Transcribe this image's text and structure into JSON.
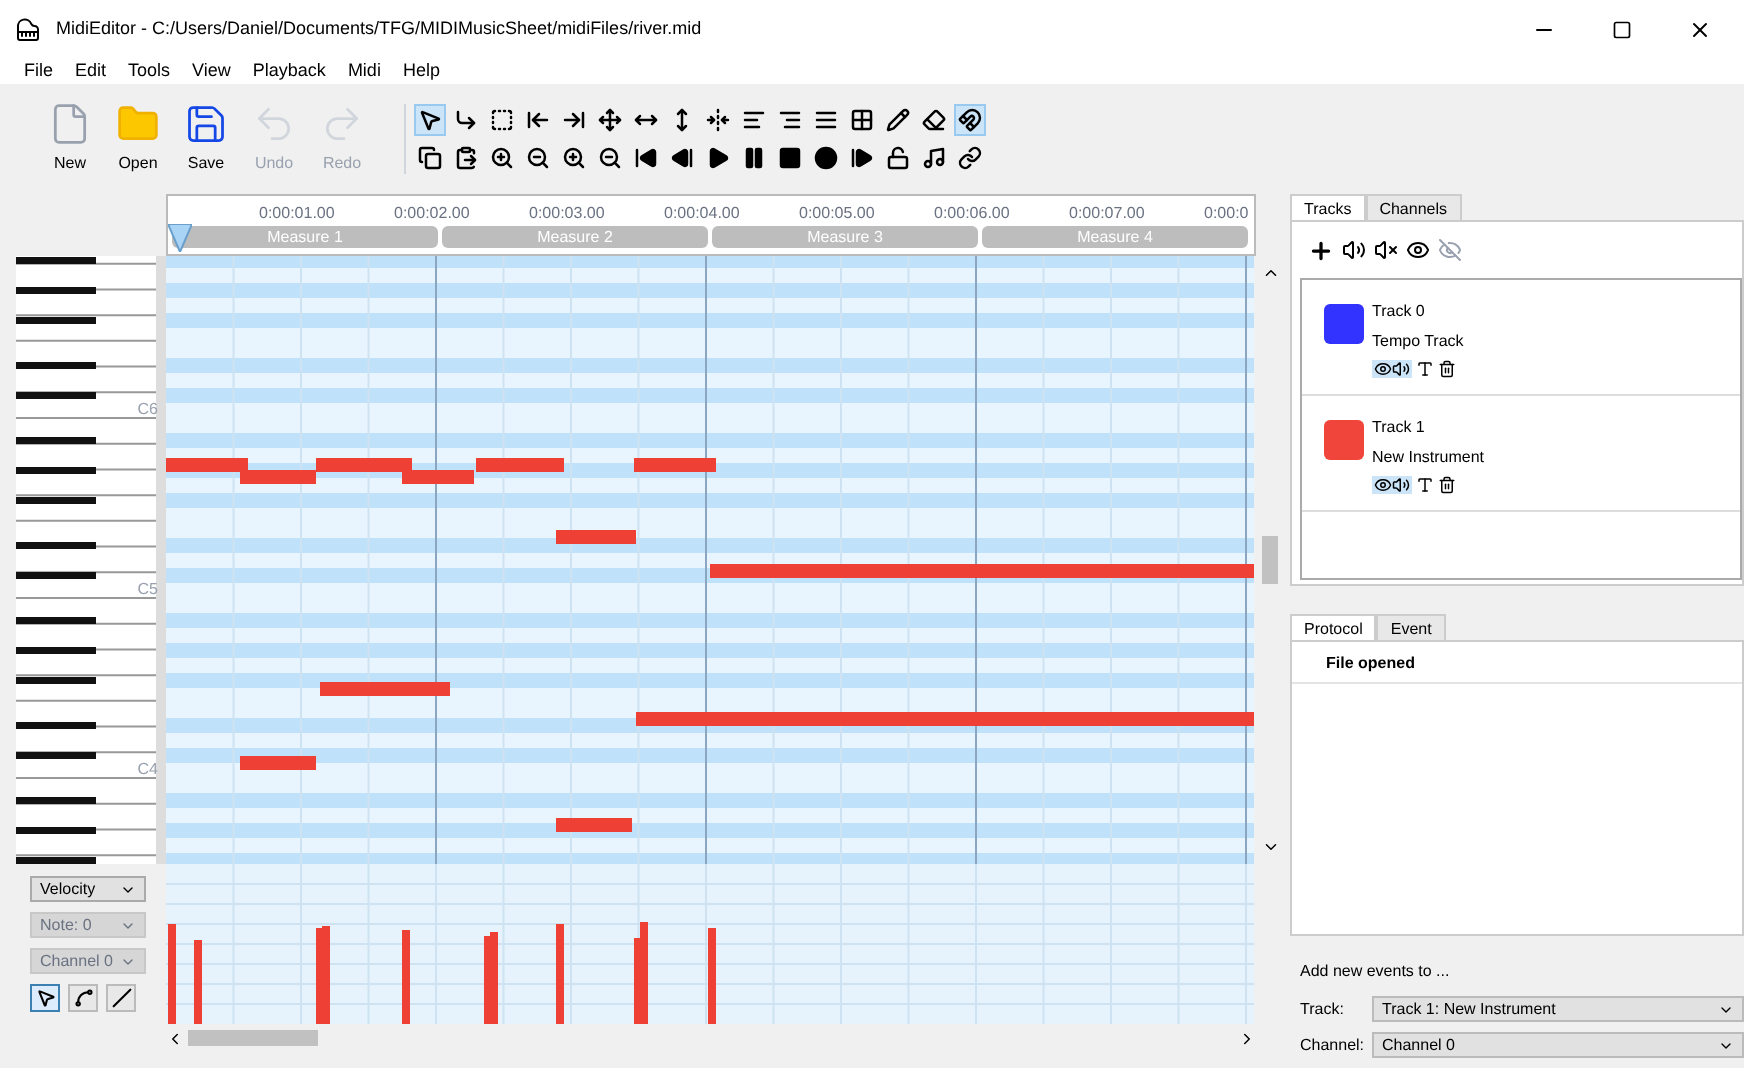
{
  "window": {
    "title": "MidiEditor - C:/Users/Daniel/Documents/TFG/MIDIMusicSheet/midiFiles/river.mid"
  },
  "menu": [
    "File",
    "Edit",
    "Tools",
    "View",
    "Playback",
    "Midi",
    "Help"
  ],
  "toolbar": {
    "large_buttons": [
      {
        "label": "New",
        "disabled": false
      },
      {
        "label": "Open",
        "disabled": false
      },
      {
        "label": "Save",
        "disabled": false
      },
      {
        "label": "Undo",
        "disabled": true
      },
      {
        "label": "Redo",
        "disabled": true
      }
    ],
    "tools": [
      {
        "selected": true
      },
      {
        "selected": false
      },
      {
        "selected": false
      },
      {
        "selected": false
      },
      {
        "selected": false
      },
      {
        "selected": false
      },
      {
        "selected": false
      },
      {
        "selected": false
      },
      {
        "selected": false
      },
      {
        "selected": false
      },
      {
        "selected": false
      },
      {
        "selected": false
      },
      {
        "selected": false
      },
      {
        "selected": false
      },
      {
        "selected": false
      },
      {
        "selected": true
      }
    ]
  },
  "timeline": {
    "ticks": [
      "0:00:01.00",
      "0:00:02.00",
      "0:00:03.00",
      "0:00:04.00",
      "0:00:05.00",
      "0:00:06.00",
      "0:00:07.00",
      "0:00:0"
    ],
    "measures": [
      "Measure 1",
      "Measure 2",
      "Measure 3",
      "Measure 4"
    ]
  },
  "keyboard": {
    "labels": [
      "C6",
      "C5",
      "C4"
    ]
  },
  "misc_panel": {
    "selects": [
      {
        "value": "Velocity",
        "disabled": false
      },
      {
        "value": "Note: 0",
        "disabled": true
      },
      {
        "value": "Channel 0",
        "disabled": true
      }
    ],
    "tools": [
      {
        "selected": true
      },
      {
        "selected": false
      },
      {
        "selected": false
      }
    ]
  },
  "right_tabs": [
    {
      "label": "Tracks",
      "selected": true
    },
    {
      "label": "Channels",
      "selected": false
    }
  ],
  "tracks": [
    {
      "name": "Track 0",
      "instrument": "Tempo Track",
      "color": "#3333ff"
    },
    {
      "name": "Track 1",
      "instrument": "New Instrument",
      "color": "#f0453a"
    }
  ],
  "bottom_tabs": [
    {
      "label": "Protocol",
      "selected": true
    },
    {
      "label": "Event",
      "selected": false
    }
  ],
  "protocol": [
    "File opened"
  ],
  "add_events": {
    "heading": "Add new events to ...",
    "fields": [
      {
        "label": "Track:",
        "value": "Track 1: New Instrument"
      },
      {
        "label": "Channel:",
        "value": "Channel 0"
      }
    ]
  }
}
